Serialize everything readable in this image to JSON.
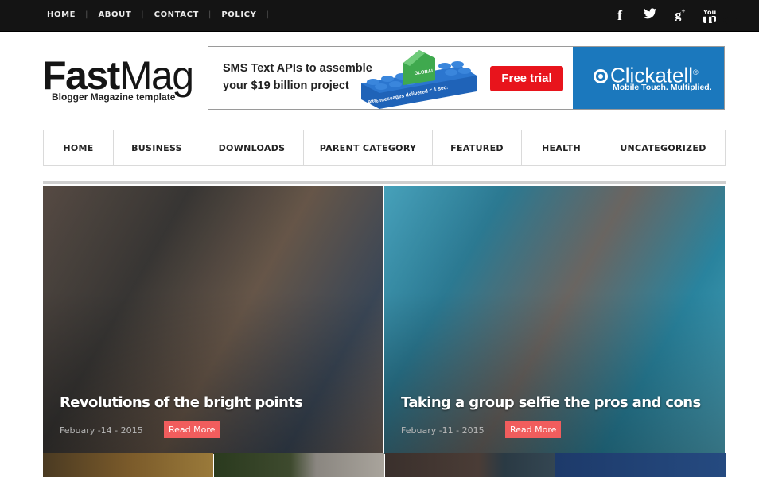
{
  "topbar": {
    "links": [
      "HOME",
      "ABOUT",
      "CONTACT",
      "POLICY"
    ],
    "separator": "|",
    "social": [
      {
        "name": "facebook-icon",
        "glyph": "f"
      },
      {
        "name": "twitter-icon",
        "glyph": "🐦"
      },
      {
        "name": "google-plus-icon",
        "glyph": "g+"
      },
      {
        "name": "youtube-icon",
        "glyph": "You Tube"
      }
    ]
  },
  "logo": {
    "bold": "Fast",
    "light": "Mag",
    "tagline": "Blogger Magazine template"
  },
  "ad": {
    "line1": "SMS Text APIs to assemble",
    "line2": "your $19 billion project",
    "lego_label": "GLOBAL",
    "lego_caption": "98% messages delivered < 1 sec.",
    "cta": "Free trial",
    "brand": "Clickatell",
    "brand_mark": "®",
    "slogan": "Mobile Touch. Multiplied.",
    "colors": {
      "cta": "#e8141c",
      "brand_bg": "#1b78bd"
    }
  },
  "mainnav": {
    "items": [
      "HOME",
      "BUSINESS",
      "DOWNLOADS",
      "PARENT CATEGORY",
      "FEATURED",
      "HEALTH",
      "UNCATEGORIZED"
    ]
  },
  "slider": {
    "posts": [
      {
        "title": "Revolutions of the bright points",
        "date": "Febuary -14 - 2015",
        "read_more": "Read More"
      },
      {
        "title": "Taking a group selfie the pros and cons",
        "date": "Febuary -11 - 2015",
        "read_more": "Read More"
      }
    ],
    "accent": "#f15d5d"
  }
}
